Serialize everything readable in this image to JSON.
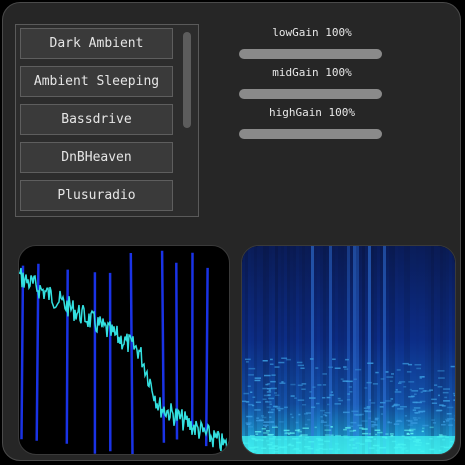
{
  "stations": [
    {
      "label": "Dark Ambient"
    },
    {
      "label": "Ambient Sleeping"
    },
    {
      "label": "Bassdrive"
    },
    {
      "label": "DnBHeaven"
    },
    {
      "label": "Plusuradio"
    }
  ],
  "gains": [
    {
      "label": "lowGain 100%",
      "value": 1.0
    },
    {
      "label": "midGain 100%",
      "value": 1.0
    },
    {
      "label": "highGain 100%",
      "value": 1.0
    }
  ],
  "colors": {
    "waveform": "#1a33e6",
    "spectrum": "#33e0e0",
    "spectrogram_low": "#0a1a66",
    "spectrogram_high": "#3ff0f0"
  }
}
